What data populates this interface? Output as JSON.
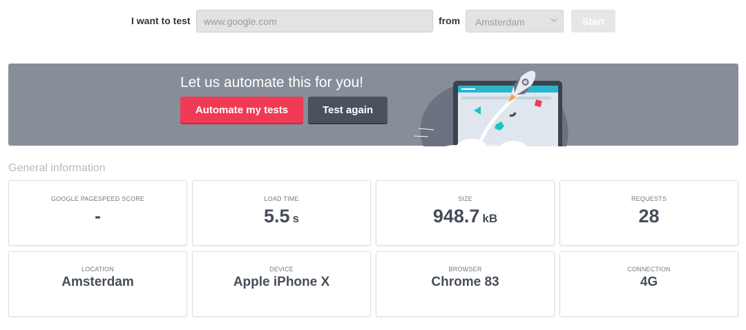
{
  "test_bar": {
    "label_want": "I want to test",
    "url_placeholder": "www.google.com",
    "label_from": "from",
    "location_selected": "Amsterdam",
    "start_label": "Start"
  },
  "banner": {
    "title": "Let us automate this for you!",
    "automate_label": "Automate my tests",
    "test_again_label": "Test again",
    "illustration_icon": "rocket-laptop-illustration"
  },
  "general": {
    "title": "General information",
    "cards": [
      {
        "label": "GOOGLE PAGESPEED SCORE",
        "value": "-",
        "unit": ""
      },
      {
        "label": "LOAD TIME",
        "value": "5.5",
        "unit": "s"
      },
      {
        "label": "SIZE",
        "value": "948.7",
        "unit": "kB"
      },
      {
        "label": "REQUESTS",
        "value": "28",
        "unit": ""
      },
      {
        "label": "LOCATION",
        "value": "Amsterdam",
        "unit": ""
      },
      {
        "label": "DEVICE",
        "value": "Apple iPhone X",
        "unit": ""
      },
      {
        "label": "BROWSER",
        "value": "Chrome 83",
        "unit": ""
      },
      {
        "label": "CONNECTION",
        "value": "4G",
        "unit": ""
      }
    ]
  },
  "colors": {
    "banner_bg": "#878e99",
    "automate_bg": "#f13a55",
    "test_again_bg": "#4a525e",
    "value_text": "#454d5a"
  }
}
